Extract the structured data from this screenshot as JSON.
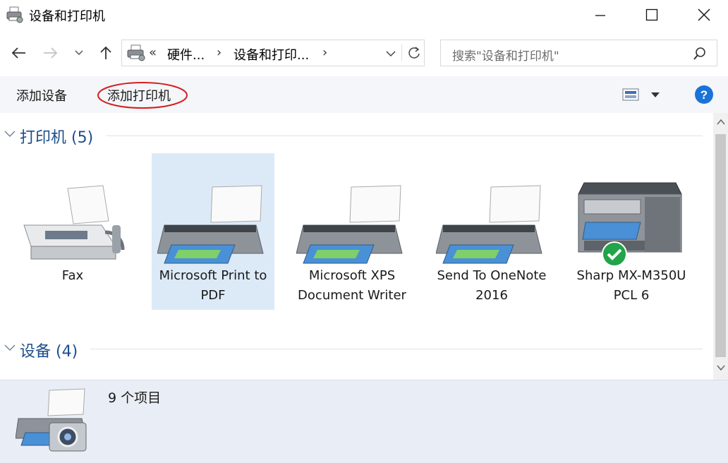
{
  "window": {
    "title": "设备和打印机",
    "controls": {
      "minimize": "—",
      "maximize": "☐",
      "close": "✕"
    }
  },
  "address": {
    "overflow": "«",
    "crumbs": [
      "硬件...",
      "设备和打印..."
    ],
    "separator": "›"
  },
  "search": {
    "placeholder": "搜索\"设备和打印机\""
  },
  "toolbar": {
    "add_device": "添加设备",
    "add_printer": "添加打印机",
    "help": "?"
  },
  "groups": {
    "printers": {
      "header": "打印机 (5)"
    },
    "devices": {
      "header": "设备 (4)"
    }
  },
  "printers": [
    {
      "label": "Fax",
      "icon": "fax-icon"
    },
    {
      "label": "Microsoft Print to PDF",
      "icon": "printer-icon",
      "selected": true
    },
    {
      "label": "Microsoft XPS Document Writer",
      "icon": "printer-icon"
    },
    {
      "label": "Send To OneNote 2016",
      "icon": "printer-icon"
    },
    {
      "label": "Sharp MX-M350U PCL 6",
      "icon": "multifunction-printer-icon",
      "default": true
    }
  ],
  "details": {
    "item_count": "9 个项目"
  },
  "colors": {
    "accent": "#1e4e8c",
    "selection": "#dceaf8",
    "help": "#1a73d9",
    "default_check": "#21a44a",
    "annotation": "#d42020"
  }
}
